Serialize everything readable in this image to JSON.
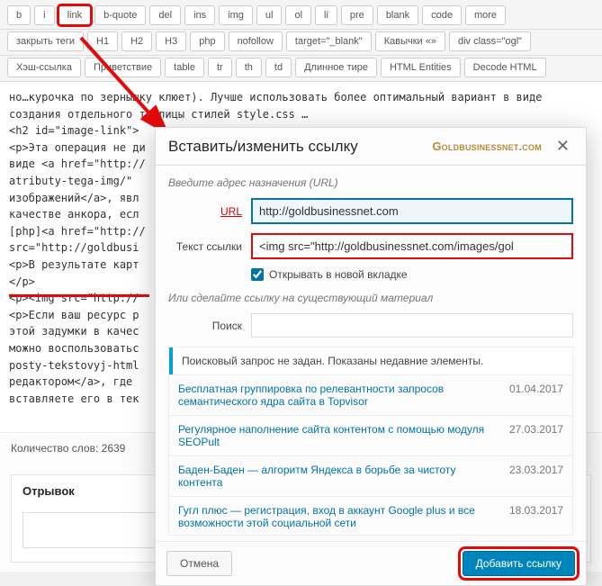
{
  "toolbar": {
    "row1": [
      "b",
      "i",
      "link",
      "b-quote",
      "del",
      "ins",
      "img",
      "ul",
      "ol",
      "li",
      "pre",
      "blank",
      "code",
      "more"
    ],
    "row2": [
      "закрыть теги",
      "H1",
      "H2",
      "H3",
      "php",
      "nofollow",
      "target=\"_blank\"",
      "Кавычки «»",
      "div class=\"ogl\""
    ],
    "row3": [
      "Хэш-ссылка",
      "Приветствие",
      "table",
      "tr",
      "th",
      "td",
      "Длинное тире",
      "HTML Entities",
      "Decode HTML"
    ]
  },
  "editor_text": "но…курочка по зернышку клюет). Лучше использовать более оптимальный вариант в виде\nсоздания отдельного таблицы стилей style.css …\n<h2 id=\"image-link\">\n<p>Эта операция не ди\nвиде <a href=\"http://\natributy-tega-img/\"\nизображений</a>, явл\nкачестве анкора, есл\n[php]<a href=\"http://\nsrc=\"http://goldbusi\n<p>В результате карт\n</p>\n<p><img src=\"http://\n<p>Если ваш ресурс р\nэтой задумки в качес\nможно воспользоватьс\nposty-tekstovyj-html\nредактором</a>, где\nвставляете его в тек",
  "word_count_label": "Количество слов:",
  "word_count_value": "2639",
  "excerpt_title": "Отрывок",
  "modal": {
    "title": "Вставить/изменить ссылку",
    "brand": "Goldbusinessnet.com",
    "hint1": "Введите адрес назначения (URL)",
    "url_label": "URL",
    "url_value": "http://goldbusinessnet.com",
    "text_label": "Текст ссылки",
    "text_value": "<img src=\"http://goldbusinessnet.com/images/gol",
    "newtab_label": "Открывать в новой вкладке",
    "newtab_checked": true,
    "hint2": "Или сделайте ссылку на существующий материал",
    "search_label": "Поиск",
    "search_value": "",
    "results_info": "Поисковый запрос не задан. Показаны недавние элементы.",
    "results": [
      {
        "title": "Бесплатная группировка по релевантности запросов семантического ядра сайта в Topvisor",
        "date": "01.04.2017"
      },
      {
        "title": "Регулярное наполнение сайта контентом с помощью модуля SEOPult",
        "date": "27.03.2017"
      },
      {
        "title": "Баден-Баден — алгоритм Яндекса в борьбе за чистоту контента",
        "date": "23.03.2017"
      },
      {
        "title": "Гугл плюс — регистрация, вход в аккаунт Google plus и все возможности этой социальной сети",
        "date": "18.03.2017"
      }
    ],
    "cancel": "Отмена",
    "submit": "Добавить ссылку"
  }
}
